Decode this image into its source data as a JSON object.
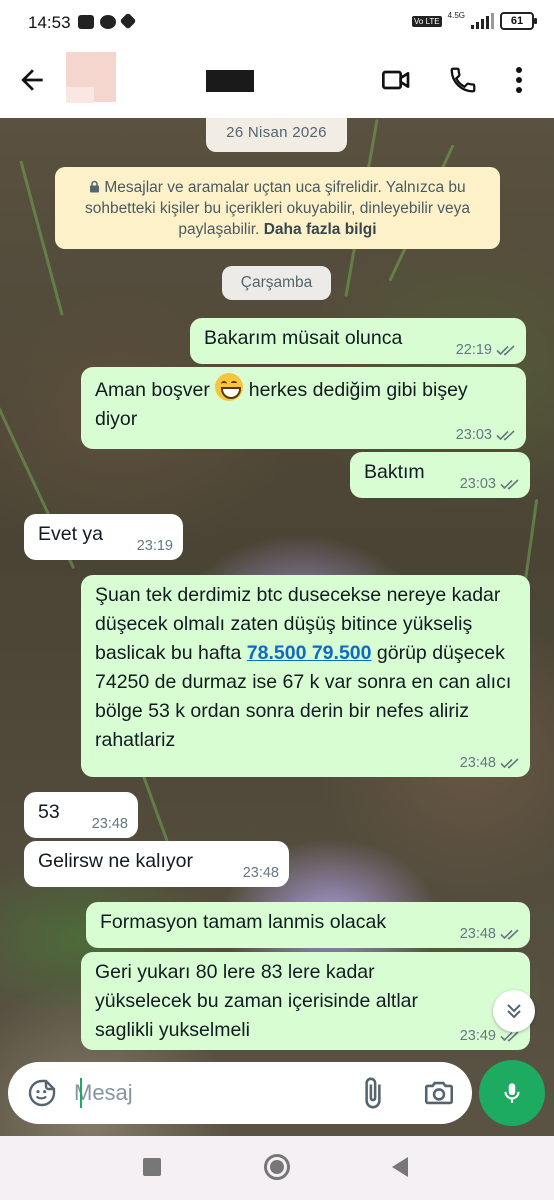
{
  "status_bar": {
    "time": "14:53",
    "network_label": "4.5G",
    "volte_label": "Vo LTE",
    "battery": "61"
  },
  "header": {
    "contact_name": "",
    "icons": [
      "back-arrow-icon",
      "video-call-icon",
      "phone-icon",
      "more-vert-icon"
    ]
  },
  "date_chip": "26 Nisan 2026",
  "encryption_notice": {
    "text": "Mesajlar ve aramalar uçtan uca şifrelidir. Yalnızca bu sohbetteki kişiler bu içerikleri okuyabilir, dinleyebilir veya paylaşabilir.",
    "link": "Daha fazla bilgi"
  },
  "day_chip": "Çarşamba",
  "messages": [
    {
      "dir": "out",
      "text": "Bakarım müsait olunca",
      "time": "22:19",
      "read": true
    },
    {
      "dir": "out",
      "text_before": "Aman boşver",
      "emoji": "grinning-face-emoji",
      "text_after": "herkes dediğim gibi bişey diyor",
      "time": "23:03",
      "read": true
    },
    {
      "dir": "out",
      "text": "Baktım",
      "time": "23:03",
      "read": true
    },
    {
      "dir": "in",
      "text": "Evet ya",
      "time": "23:19"
    },
    {
      "dir": "out",
      "text_before": "Şuan tek derdimiz btc dusecekse nereye kadar düşecek olmalı zaten düşüş bitince yükseliş baslicak bu hafta",
      "link": "78.500 79.500",
      "text_after": "görüp düşecek 74250 de durmaz ise 67 k var sonra en can alıcı bölge 53 k ordan sonra derin bir nefes aliriz rahatlariz",
      "time": "23:48",
      "read": true
    },
    {
      "dir": "in",
      "text": "53",
      "time": "23:48"
    },
    {
      "dir": "in",
      "text": "Gelirsw ne kalıyor",
      "time": "23:48"
    },
    {
      "dir": "out",
      "text": "Formasyon tamam lanmis olacak",
      "time": "23:48",
      "read": true
    },
    {
      "dir": "out",
      "text": "Geri yukarı 80 lere 83 lere kadar yükselecek bu zaman içerisinde altlar saglikli yukselmeli",
      "time": "23:49",
      "read": true
    }
  ],
  "composer": {
    "placeholder": "Mesaj"
  },
  "colors": {
    "outgoing_bubble": "#d9fdd3",
    "incoming_bubble": "#ffffff",
    "accent_green": "#1daa61",
    "link": "#0c6bc4"
  }
}
